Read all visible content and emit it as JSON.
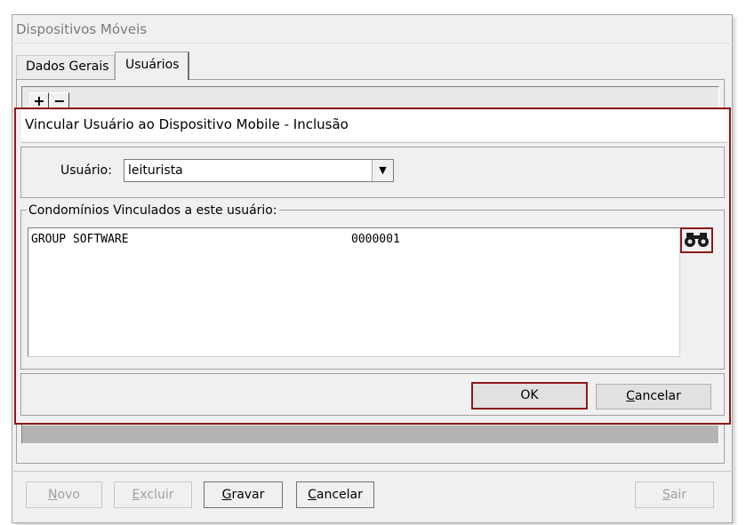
{
  "window": {
    "title": "Dispositivos Móveis"
  },
  "tabs": [
    {
      "label": "Dados Gerais",
      "active": false
    },
    {
      "label": "Usuários",
      "active": true
    }
  ],
  "panel": {
    "add_label": "+",
    "remove_label": "−"
  },
  "modal": {
    "title": "Vincular Usuário ao Dispositivo Mobile - Inclusão",
    "user_label": "Usuário:",
    "user_value": "leituristа",
    "linked_legend": "Condomínios Vinculados a este usuário:",
    "linked_rows": [
      {
        "name": "GROUP SOFTWARE",
        "code": "0000001"
      }
    ],
    "search_icon": "binoculars-icon",
    "ok_label": "OK",
    "cancel_label": "Cancelar",
    "highlight_color": "#8b1a1a"
  },
  "toolbar": {
    "novo": "Novo",
    "excluir": "Excluir",
    "gravar": "Gravar",
    "cancelar": "Cancelar",
    "sair": "Sair"
  }
}
